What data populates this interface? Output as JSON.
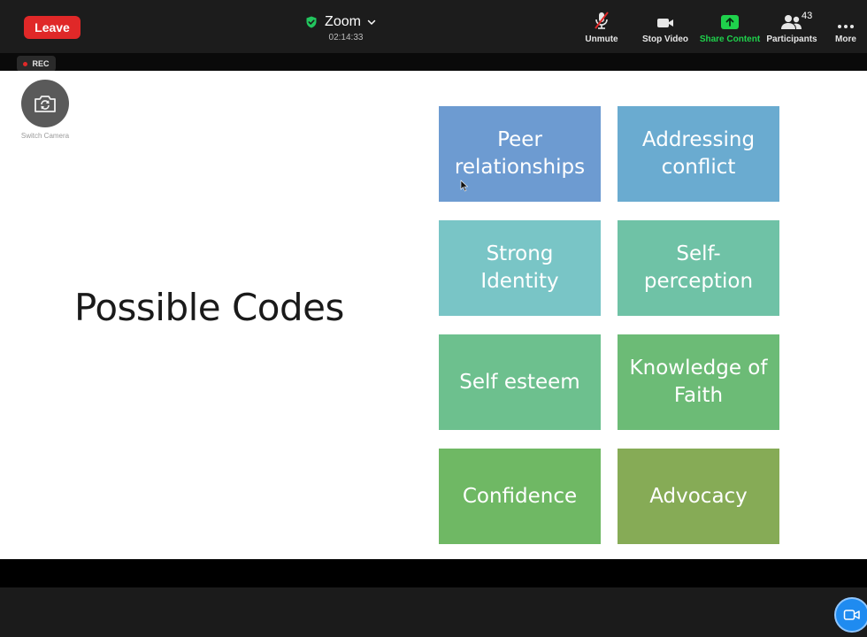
{
  "toolbar": {
    "leave_label": "Leave",
    "app_title": "Zoom",
    "timer": "02:14:33",
    "unmute_label": "Unmute",
    "stop_video_label": "Stop Video",
    "share_label": "Share Content",
    "participants_label": "Participants",
    "participants_count": "43",
    "more_label": "More"
  },
  "recording": {
    "label": "REC"
  },
  "camera": {
    "switch_label": "Switch Camera"
  },
  "slide": {
    "title": "Possible Codes",
    "tiles": [
      {
        "label": "Peer relationships",
        "color": "#6d9bd1"
      },
      {
        "label": "Addressing conflict",
        "color": "#6aabd0"
      },
      {
        "label": "Strong Identity",
        "color": "#79c5c6"
      },
      {
        "label": "Self-perception",
        "color": "#6fc2a6"
      },
      {
        "label": "Self esteem",
        "color": "#6dc08e"
      },
      {
        "label": "Knowledge of Faith",
        "color": "#6cbb76"
      },
      {
        "label": "Confidence",
        "color": "#6fb864"
      },
      {
        "label": "Advocacy",
        "color": "#86ab56"
      }
    ]
  },
  "colors": {
    "leave": "#e02828",
    "share_green": "#1fd14c",
    "shield_green": "#22c55e",
    "fab_blue": "#1f8bf0"
  }
}
